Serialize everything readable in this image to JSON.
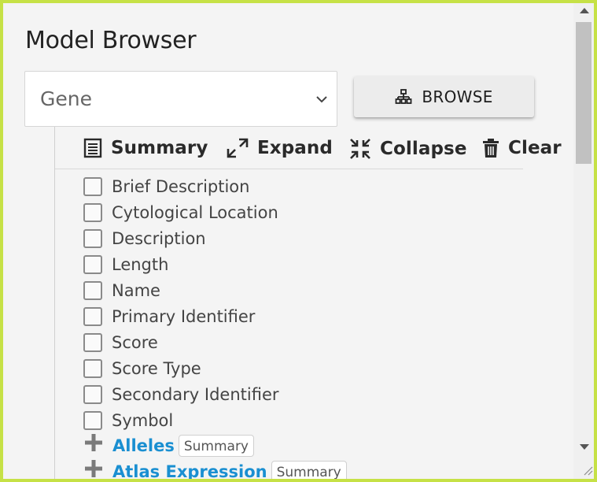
{
  "title": "Model Browser",
  "class_select": {
    "value": "Gene"
  },
  "browse_button": {
    "label": "BROWSE"
  },
  "toolbar": {
    "summary": "Summary",
    "expand": "Expand",
    "collapse": "Collapse",
    "clear": "Clear"
  },
  "attributes": [
    "Brief Description",
    "Cytological Location",
    "Description",
    "Length",
    "Name",
    "Primary Identifier",
    "Score",
    "Score Type",
    "Secondary Identifier",
    "Symbol"
  ],
  "references": [
    {
      "name": "Alleles",
      "tag": "Summary"
    },
    {
      "name": "Atlas Expression",
      "tag": "Summary"
    }
  ],
  "colors": {
    "outer_border": "#c6e146",
    "link": "#1a8fd1",
    "panel_bg": "#f4f4f4"
  }
}
